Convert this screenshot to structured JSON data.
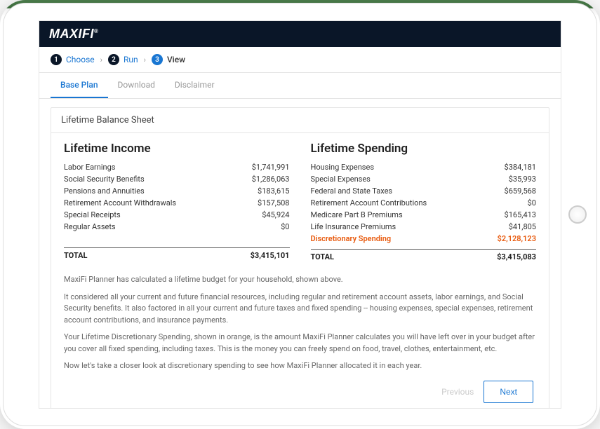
{
  "brand": "MAXIFI",
  "stepper": {
    "steps": [
      {
        "num": "1",
        "label": "Choose"
      },
      {
        "num": "2",
        "label": "Run"
      },
      {
        "num": "3",
        "label": "View"
      }
    ]
  },
  "tabs": {
    "items": [
      {
        "label": "Base Plan"
      },
      {
        "label": "Download"
      },
      {
        "label": "Disclaimer"
      }
    ]
  },
  "panel": {
    "title": "Lifetime Balance Sheet",
    "income": {
      "heading": "Lifetime Income",
      "rows": [
        {
          "label": "Labor Earnings",
          "value": "$1,741,991"
        },
        {
          "label": "Social Security Benefits",
          "value": "$1,286,063"
        },
        {
          "label": "Pensions and Annuities",
          "value": "$183,615"
        },
        {
          "label": "Retirement Account Withdrawals",
          "value": "$157,508"
        },
        {
          "label": "Special Receipts",
          "value": "$45,924"
        },
        {
          "label": "Regular Assets",
          "value": "$0"
        }
      ],
      "total_label": "TOTAL",
      "total_value": "$3,415,101"
    },
    "spending": {
      "heading": "Lifetime Spending",
      "rows": [
        {
          "label": "Housing Expenses",
          "value": "$384,181"
        },
        {
          "label": "Special Expenses",
          "value": "$35,993"
        },
        {
          "label": "Federal and State Taxes",
          "value": "$659,568"
        },
        {
          "label": "Retirement Account Contributions",
          "value": "$0"
        },
        {
          "label": "Medicare Part B Premiums",
          "value": "$165,413"
        },
        {
          "label": "Life Insurance Premiums",
          "value": "$41,805"
        },
        {
          "label": "Discretionary Spending",
          "value": "$2,128,123",
          "highlight": true
        }
      ],
      "total_label": "TOTAL",
      "total_value": "$3,415,083"
    },
    "explanation": {
      "p1": "MaxiFi Planner has calculated a lifetime budget for your household, shown above.",
      "p2": "It considered all your current and future financial resources, including regular and retirement account assets, labor earnings, and Social Security benefits. It also factored in all your current and future taxes and fixed spending -- housing expenses, special expenses, retirement account contributions, and insurance payments.",
      "p3": "Your Lifetime Discretionary Spending, shown in orange, is the amount MaxiFi Planner calculates you will have left over in your budget after you cover all fixed spending, including taxes. This is the money you can freely spend on food, travel, clothes, entertainment, etc.",
      "p4": "Now let's take a closer look at discretionary spending to see how MaxiFi Planner allocated it in each year."
    }
  },
  "nav": {
    "previous": "Previous",
    "next": "Next"
  }
}
